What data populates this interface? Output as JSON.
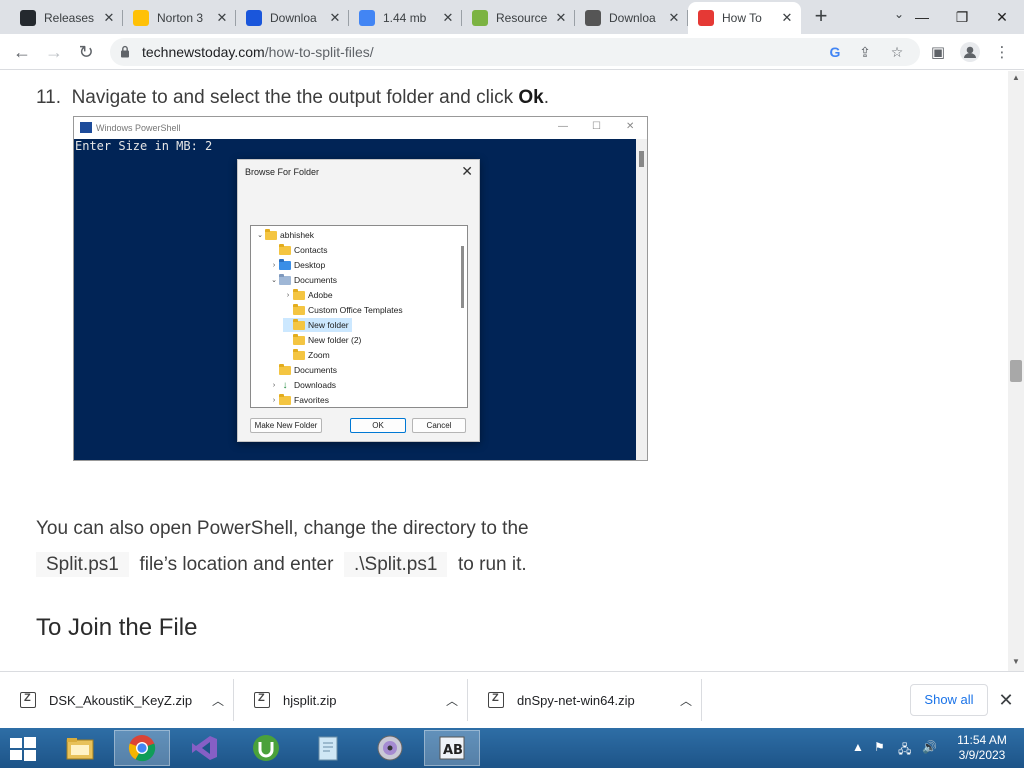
{
  "browser": {
    "tabs": [
      {
        "title": "Releases",
        "favicon": "github",
        "color": "#24292e"
      },
      {
        "title": "Norton 3",
        "favicon": "norton",
        "color": "#ffc107"
      },
      {
        "title": "Downloa",
        "favicon": "u-shield",
        "color": "#1a56db"
      },
      {
        "title": "1.44 mb",
        "favicon": "google",
        "color": "#4285f4"
      },
      {
        "title": "Resource",
        "favicon": "aj",
        "color": "#7cb342"
      },
      {
        "title": "Downloa",
        "favicon": "a-logo",
        "color": "#555555"
      },
      {
        "title": "How To",
        "favicon": "tnt",
        "color": "#e53935"
      }
    ],
    "new_tab_label": "+",
    "url_domain": "technewstoday.com",
    "url_path": "/how-to-split-files/"
  },
  "article": {
    "step_number": "11.",
    "step_text": "Navigate to and select the the output folder and click ",
    "step_bold": "Ok",
    "step_end": ".",
    "para_line1": "You can also open PowerShell, change the directory to the",
    "code1": "Split.ps1",
    "para_mid": "file’s location and enter",
    "code2": ".\\Split.ps1",
    "para_end": "to run it.",
    "heading": "To Join the File"
  },
  "screenshot": {
    "window_title": "Windows PowerShell",
    "console_text": "Enter Size in MB: 2",
    "dialog_title": "Browse For Folder",
    "tree": [
      {
        "label": "abhishek",
        "indent": 0,
        "tw": "⌄",
        "icon": "folder"
      },
      {
        "label": "Contacts",
        "indent": 1,
        "tw": "",
        "icon": "folder"
      },
      {
        "label": "Desktop",
        "indent": 1,
        "tw": "›",
        "icon": "blue"
      },
      {
        "label": "Documents",
        "indent": 1,
        "tw": "⌄",
        "icon": "doc"
      },
      {
        "label": "Adobe",
        "indent": 2,
        "tw": "›",
        "icon": "folder"
      },
      {
        "label": "Custom Office Templates",
        "indent": 2,
        "tw": "",
        "icon": "folder"
      },
      {
        "label": "New folder",
        "indent": 2,
        "tw": "",
        "icon": "folder",
        "selected": true
      },
      {
        "label": "New folder (2)",
        "indent": 2,
        "tw": "",
        "icon": "folder"
      },
      {
        "label": "Zoom",
        "indent": 2,
        "tw": "",
        "icon": "folder"
      },
      {
        "label": "Documents",
        "indent": 1,
        "tw": "",
        "icon": "folder"
      },
      {
        "label": "Downloads",
        "indent": 1,
        "tw": "›",
        "icon": "download"
      },
      {
        "label": "Favorites",
        "indent": 1,
        "tw": "›",
        "icon": "folder"
      }
    ],
    "btn_make_folder": "Make New Folder",
    "btn_ok": "OK",
    "btn_cancel": "Cancel"
  },
  "downloads": {
    "items": [
      {
        "name": "DSK_AkoustiK_KeyZ.zip"
      },
      {
        "name": "hjsplit.zip"
      },
      {
        "name": "dnSpy-net-win64.zip"
      }
    ],
    "show_all": "Show all"
  },
  "taskbar": {
    "time": "11:54 AM",
    "date": "3/9/2023"
  }
}
